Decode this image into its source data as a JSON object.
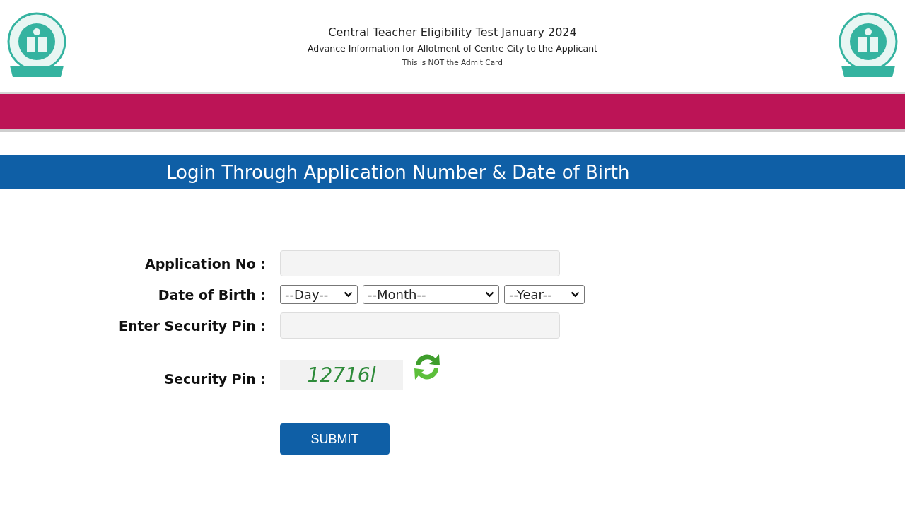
{
  "header": {
    "title": "Central Teacher Eligibility Test January 2024",
    "subtitle": "Advance Information for Allotment of Centre City to the Applicant",
    "note": "This is NOT the Admit Card"
  },
  "login_bar": {
    "title": "Login Through Application Number & Date of Birth"
  },
  "form": {
    "application_no": {
      "label": "Application No :"
    },
    "date_of_birth": {
      "label": "Date of Birth :",
      "selects": [
        "--Day--",
        "--Month--",
        "--Year--"
      ]
    },
    "enter_security_pin": {
      "label": "Enter Security Pin :"
    },
    "security_pin": {
      "label": "Security Pin :",
      "captcha": "12716l"
    },
    "submit": "SUBMIT"
  }
}
